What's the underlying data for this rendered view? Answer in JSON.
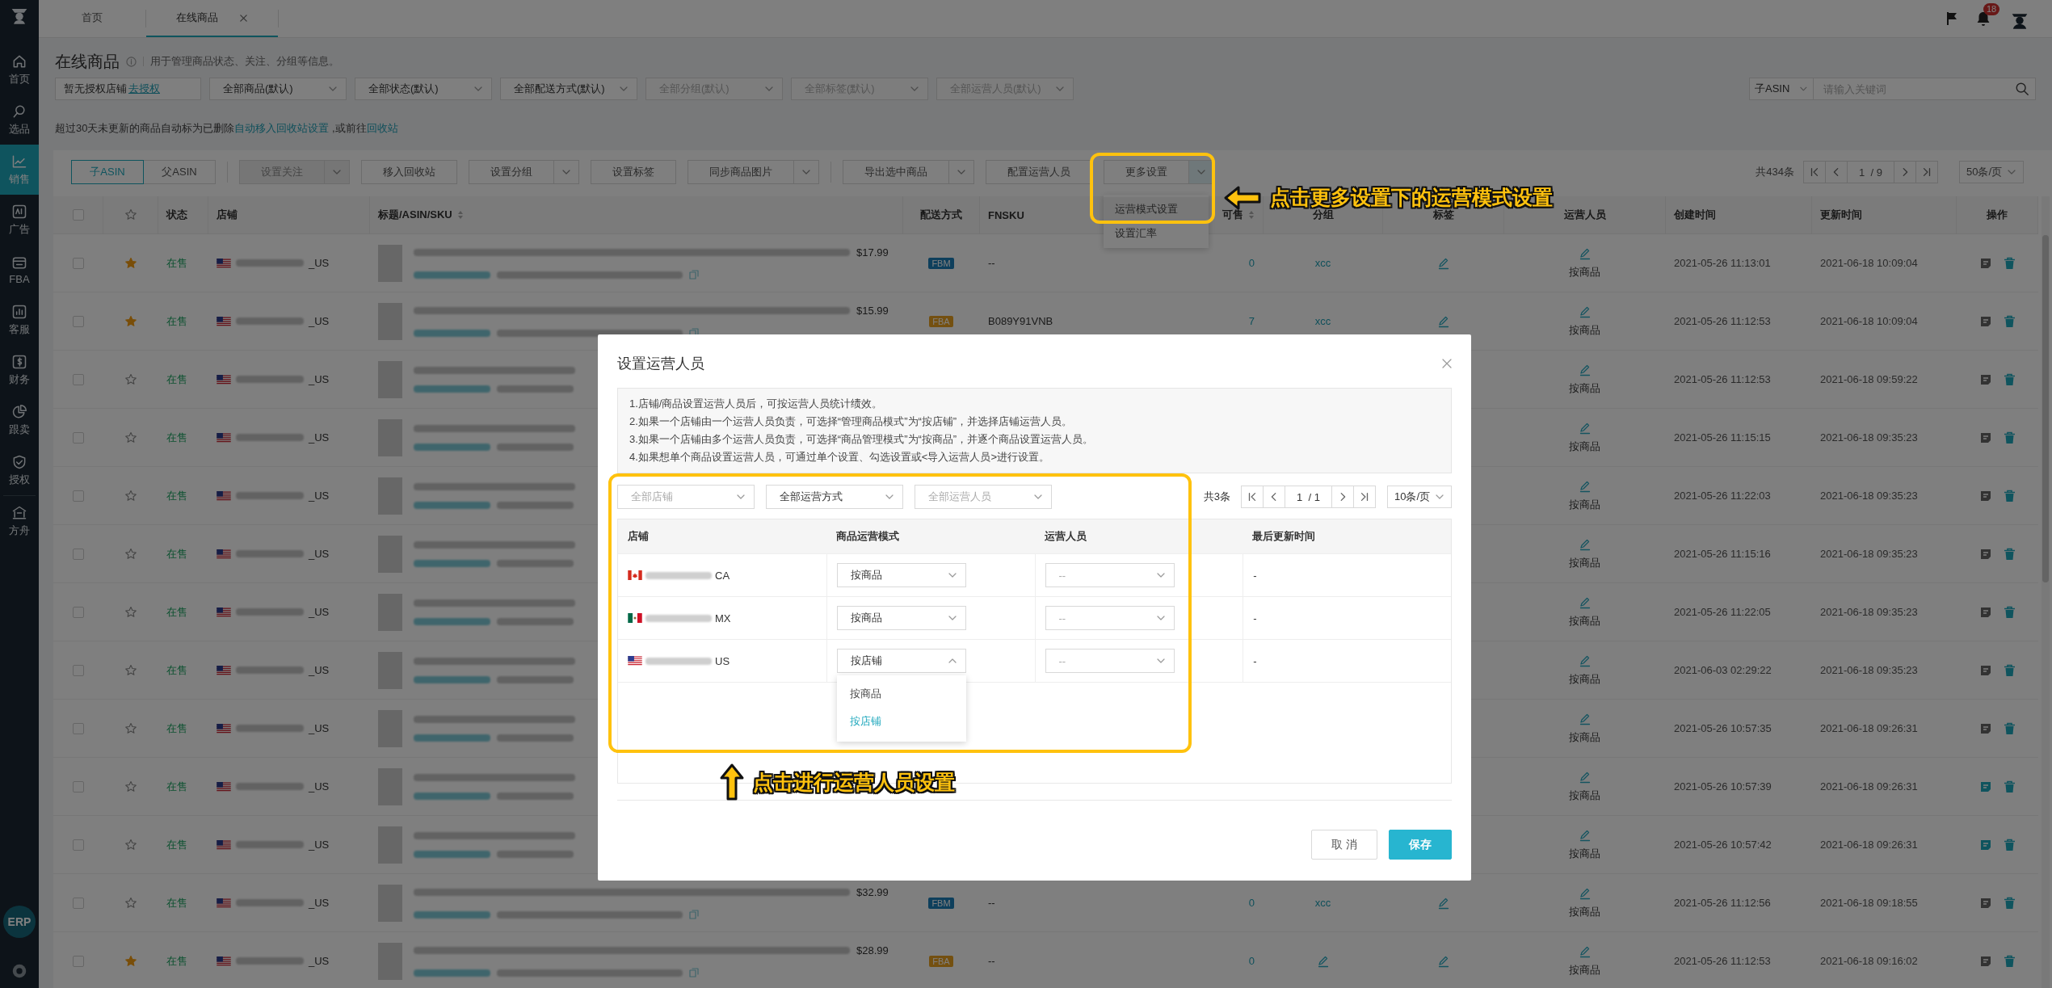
{
  "sidebar": {
    "items": [
      {
        "label": "首页",
        "selected": false
      },
      {
        "label": "选品",
        "selected": false
      },
      {
        "label": "销售",
        "selected": true
      },
      {
        "label": "广告",
        "selected": false
      },
      {
        "label": "FBA",
        "selected": false
      },
      {
        "label": "客服",
        "selected": false
      },
      {
        "label": "财务",
        "selected": false
      },
      {
        "label": "跟卖",
        "selected": false
      },
      {
        "label": "授权",
        "selected": false
      },
      {
        "label": "方舟",
        "selected": false
      }
    ],
    "badge": "ERP"
  },
  "tabs": [
    {
      "label": "首页",
      "selected": false,
      "closable": false
    },
    {
      "label": "在线商品",
      "selected": true,
      "closable": true
    }
  ],
  "notifications": "18",
  "page": {
    "title": "在线商品",
    "description": "用于管理商品状态、关注、分组等信息。"
  },
  "filters": {
    "store_notice": "暂无授权店铺",
    "store_link": "去授权",
    "selects": [
      {
        "value": "全部商品(默认)",
        "disabled": false
      },
      {
        "value": "全部状态(默认)",
        "disabled": false
      },
      {
        "value": "全部配送方式(默认)",
        "disabled": false
      },
      {
        "value": "全部分组(默认)",
        "disabled": true
      },
      {
        "value": "全部标签(默认)",
        "disabled": true
      },
      {
        "value": "全部运营人员(默认)",
        "disabled": true
      }
    ],
    "search_scope": "子ASIN",
    "search_placeholder": "请输入关键词"
  },
  "notice": {
    "text": "超过30天未更新的商品自动标为已删除",
    "link": "自动移入回收站设置",
    "text_2": " ,或前往",
    "link_2": "回收站"
  },
  "toolbar": {
    "views": [
      {
        "label": "子ASIN",
        "selected": true
      },
      {
        "label": "父ASIN",
        "selected": false
      }
    ],
    "button_groups": [
      [
        {
          "label": "设置关注",
          "split": true,
          "disabled": true,
          "expanded": false
        },
        {
          "label": "移入回收站",
          "split": false,
          "disabled": false
        },
        {
          "label": "设置分组",
          "split": true,
          "disabled": false,
          "expanded": false
        },
        {
          "label": "设置标签",
          "split": false,
          "disabled": false
        },
        {
          "label": "同步商品图片",
          "split": true,
          "disabled": false,
          "expanded": false
        }
      ],
      [
        {
          "label": "导出选中商品",
          "split": true,
          "disabled": false,
          "expanded": false
        },
        {
          "label": "配置运营人员",
          "split": false,
          "disabled": false
        },
        {
          "label": "更多设置",
          "split": true,
          "disabled": false,
          "expanded": true,
          "menu": [
            "运营模式设置",
            "设置汇率"
          ]
        }
      ]
    ],
    "total": "共434条",
    "pager": {
      "page": "1",
      "pages": "/ 9"
    },
    "page_size": "50条/页",
    "callout": {
      "text": "点击更多设置下的运营模式设置"
    }
  },
  "table": {
    "all_checked": false,
    "columns": [
      {
        "label": "状态",
        "sortable": false
      },
      {
        "label": "店铺",
        "sortable": false
      },
      {
        "label": "标题/ASIN/SKU",
        "sortable": true
      },
      {
        "label": "配送方式",
        "sortable": false
      },
      {
        "label": "FNSKU",
        "sortable": false
      },
      {
        "label": "可售",
        "sortable": true
      },
      {
        "label": "分组",
        "sortable": false
      },
      {
        "label": "标签",
        "sortable": false
      },
      {
        "label": "运营人员",
        "sortable": false
      },
      {
        "label": "创建时间",
        "sortable": false
      },
      {
        "label": "更新时间",
        "sortable": false
      },
      {
        "label": "操作",
        "sortable": false
      }
    ],
    "rows": [
      {
        "checked": false,
        "starred": true,
        "status": "在售",
        "store_suffix": "_US",
        "price": "$17.99",
        "fulfillment": {
          "label": "FBM",
          "kind": "fbm"
        },
        "fnsku": "--",
        "stock": "0",
        "group": {
          "kind": "text",
          "text": "xcc"
        },
        "tags": {
          "kind": "edit"
        },
        "operator_mode": "按商品",
        "created": "2021-05-26 11:13:01",
        "updated": "2021-06-18 10:09:04",
        "note_active": false
      },
      {
        "checked": false,
        "starred": true,
        "status": "在售",
        "store_suffix": "_US",
        "price": "$15.99",
        "fulfillment": {
          "label": "FBA",
          "kind": "fba"
        },
        "fnsku": "B089Y91VNB",
        "stock": "7",
        "group": {
          "kind": "text",
          "text": "xcc"
        },
        "tags": {
          "kind": "edit"
        },
        "operator_mode": "按商品",
        "created": "2021-05-26 11:12:53",
        "updated": "2021-06-18 10:09:04",
        "note_active": false
      },
      {
        "checked": false,
        "starred": false,
        "status": "在售",
        "store_suffix": "_US",
        "operator_mode": "按商品",
        "created": "2021-05-26 11:12:53",
        "updated": "2021-06-18 09:59:22",
        "note_active": false
      },
      {
        "checked": false,
        "starred": false,
        "status": "在售",
        "store_suffix": "_US",
        "operator_mode": "按商品",
        "created": "2021-05-26 11:15:15",
        "updated": "2021-06-18 09:35:23",
        "note_active": false
      },
      {
        "checked": false,
        "starred": false,
        "status": "在售",
        "store_suffix": "_US",
        "operator_mode": "按商品",
        "created": "2021-05-26 11:22:03",
        "updated": "2021-06-18 09:35:23",
        "note_active": false
      },
      {
        "checked": false,
        "starred": false,
        "status": "在售",
        "store_suffix": "_US",
        "operator_mode": "按商品",
        "created": "2021-05-26 11:15:16",
        "updated": "2021-06-18 09:35:23",
        "note_active": false
      },
      {
        "checked": false,
        "starred": false,
        "status": "在售",
        "store_suffix": "_US",
        "operator_mode": "按商品",
        "created": "2021-05-26 11:22:05",
        "updated": "2021-06-18 09:35:23",
        "note_active": false
      },
      {
        "checked": false,
        "starred": false,
        "status": "在售",
        "store_suffix": "_US",
        "operator_mode": "按商品",
        "created": "2021-06-03 02:29:22",
        "updated": "2021-06-18 09:35:23",
        "note_active": false
      },
      {
        "checked": false,
        "starred": false,
        "status": "在售",
        "store_suffix": "_US",
        "operator_mode": "按商品",
        "created": "2021-05-26 10:57:35",
        "updated": "2021-06-18 09:26:31",
        "note_active": false
      },
      {
        "checked": false,
        "starred": false,
        "status": "在售",
        "store_suffix": "_US",
        "operator_mode": "按商品",
        "created": "2021-05-26 10:57:39",
        "updated": "2021-06-18 09:26:31",
        "note_active": true
      },
      {
        "checked": false,
        "starred": false,
        "status": "在售",
        "store_suffix": "_US",
        "operator_mode": "按商品",
        "created": "2021-05-26 10:57:42",
        "updated": "2021-06-18 09:26:31",
        "note_active": true
      },
      {
        "checked": false,
        "starred": false,
        "status": "在售",
        "store_suffix": "_US",
        "price": "$32.99",
        "fulfillment": {
          "label": "FBM",
          "kind": "fbm"
        },
        "fnsku": "--",
        "stock": "0",
        "group": {
          "kind": "text",
          "text": "xcc"
        },
        "tags": {
          "kind": "edit"
        },
        "operator_mode": "按商品",
        "created": "2021-05-26 11:12:56",
        "updated": "2021-06-18 09:18:55",
        "note_active": false
      },
      {
        "checked": false,
        "starred": true,
        "status": "在售",
        "store_suffix": "_US",
        "price": "$28.99",
        "fulfillment": {
          "label": "FBA",
          "kind": "fba"
        },
        "fnsku": "--",
        "stock": "0",
        "group": {
          "kind": "edit"
        },
        "tags": {
          "kind": "edit"
        },
        "operator_mode": "按商品",
        "created": "2021-05-26 11:12:53",
        "updated": "2021-06-18 09:16:02",
        "note_active": false
      }
    ]
  },
  "modal": {
    "title": "设置运营人员",
    "tips": [
      "1.店铺/商品设置运营人员后，可按运营人员统计绩效。",
      "2.如果一个店铺由一个运营人员负责，可选择“管理商品模式”为“按店铺”，并选择店铺运营人员。",
      "3.如果一个店铺由多个运营人员负责，可选择“商品管理模式”为“按商品”，并逐个商品设置运营人员。",
      "4.如果想单个商品设置运营人员，可通过单个设置、勾选设置或<导入运营人员>进行设置。"
    ],
    "filters": [
      {
        "placeholder": "全部店铺"
      },
      {
        "value": "全部运营方式"
      },
      {
        "placeholder": "全部运营人员"
      }
    ],
    "total": "共3条",
    "pager": {
      "page": "1",
      "pages": "/ 1"
    },
    "page_size": "10条/页",
    "columns": [
      "店铺",
      "商品运营模式",
      "运营人员",
      "最后更新时间"
    ],
    "rows": [
      {
        "kind": "ca",
        "store_suffix": "CA",
        "mode": "按商品",
        "expanded": false,
        "operator_placeholder": "--",
        "updated": "-"
      },
      {
        "kind": "mx",
        "store_suffix": "MX",
        "mode": "按商品",
        "expanded": false,
        "operator_placeholder": "--",
        "updated": "-"
      },
      {
        "kind": "us",
        "store_suffix": "US",
        "mode": "按店铺",
        "expanded": true,
        "operator_placeholder": "--",
        "updated": "-",
        "options": [
          {
            "label": "按商品",
            "selected": false
          },
          {
            "label": "按店铺",
            "selected": true
          }
        ]
      }
    ],
    "buttons": [
      {
        "label": "取 消",
        "kind": "secondary"
      },
      {
        "label": "保存",
        "kind": "primary"
      }
    ],
    "callout": {
      "text": "点击进行运营人员设置"
    }
  }
}
